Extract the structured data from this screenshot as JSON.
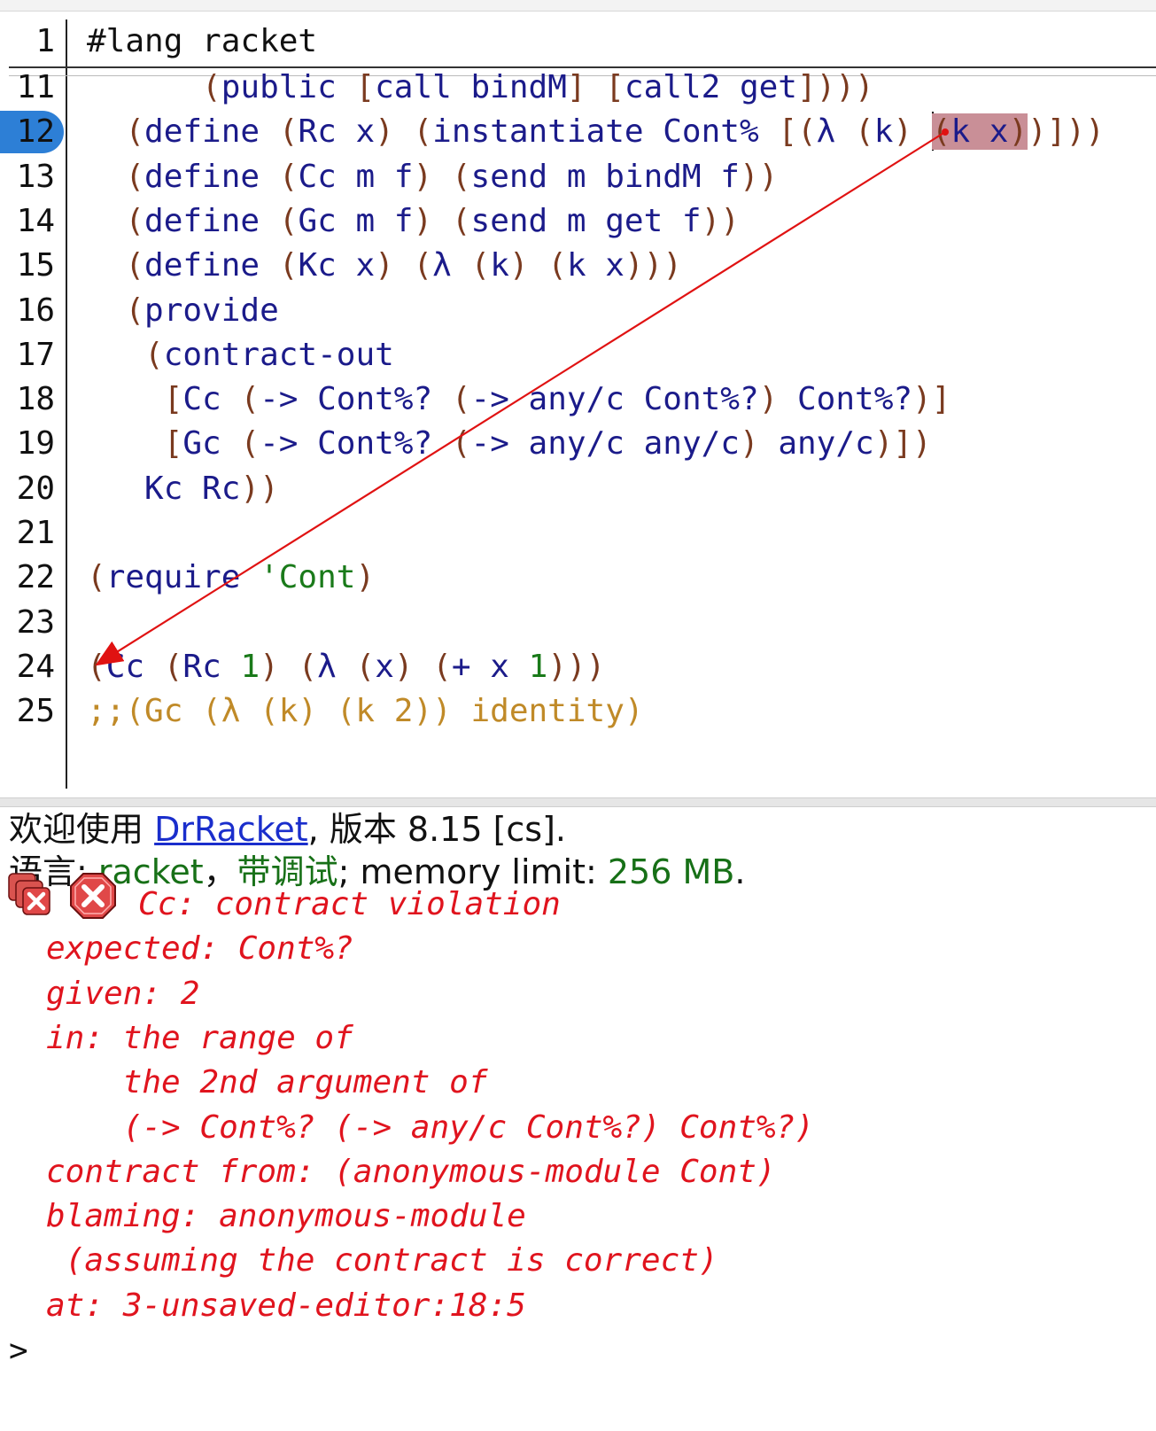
{
  "editor": {
    "header_line": {
      "number": "1",
      "text": "#lang racket"
    },
    "current_line": "12",
    "lines": [
      {
        "number": "11",
        "segments": [
          {
            "t": "      (",
            "c": "paren"
          },
          {
            "t": "public ",
            "c": "sym"
          },
          {
            "t": "[",
            "c": "paren"
          },
          {
            "t": "call bindM",
            "c": "sym"
          },
          {
            "t": "] [",
            "c": "paren"
          },
          {
            "t": "call2 get",
            "c": "sym"
          },
          {
            "t": "])))",
            "c": "paren"
          }
        ]
      },
      {
        "number": "12",
        "segments": [
          {
            "t": "  (",
            "c": "paren"
          },
          {
            "t": "define ",
            "c": "sym"
          },
          {
            "t": "(",
            "c": "paren"
          },
          {
            "t": "Rc x",
            "c": "sym"
          },
          {
            "t": ") (",
            "c": "paren"
          },
          {
            "t": "instantiate Cont% ",
            "c": "sym"
          },
          {
            "t": "[(",
            "c": "paren"
          },
          {
            "t": "λ ",
            "c": "sym"
          },
          {
            "t": "(",
            "c": "paren"
          },
          {
            "t": "k",
            "c": "sym"
          },
          {
            "t": ") ",
            "c": "paren"
          },
          {
            "t": "CURSOR",
            "c": "cursor"
          },
          {
            "t": "(",
            "c": "paren",
            "hl": true
          },
          {
            "t": "k x",
            "c": "sym",
            "hl": true
          },
          {
            "t": ")",
            "c": "paren",
            "hl": true
          },
          {
            "t": ")]))",
            "c": "paren"
          }
        ]
      },
      {
        "number": "13",
        "segments": [
          {
            "t": "  (",
            "c": "paren"
          },
          {
            "t": "define ",
            "c": "sym"
          },
          {
            "t": "(",
            "c": "paren"
          },
          {
            "t": "Cc m f",
            "c": "sym"
          },
          {
            "t": ") (",
            "c": "paren"
          },
          {
            "t": "send m bindM f",
            "c": "sym"
          },
          {
            "t": "))",
            "c": "paren"
          }
        ]
      },
      {
        "number": "14",
        "segments": [
          {
            "t": "  (",
            "c": "paren"
          },
          {
            "t": "define ",
            "c": "sym"
          },
          {
            "t": "(",
            "c": "paren"
          },
          {
            "t": "Gc m f",
            "c": "sym"
          },
          {
            "t": ") (",
            "c": "paren"
          },
          {
            "t": "send m get f",
            "c": "sym"
          },
          {
            "t": "))",
            "c": "paren"
          }
        ]
      },
      {
        "number": "15",
        "segments": [
          {
            "t": "  (",
            "c": "paren"
          },
          {
            "t": "define ",
            "c": "sym"
          },
          {
            "t": "(",
            "c": "paren"
          },
          {
            "t": "Kc x",
            "c": "sym"
          },
          {
            "t": ") (",
            "c": "paren"
          },
          {
            "t": "λ ",
            "c": "sym"
          },
          {
            "t": "(",
            "c": "paren"
          },
          {
            "t": "k",
            "c": "sym"
          },
          {
            "t": ") (",
            "c": "paren"
          },
          {
            "t": "k x",
            "c": "sym"
          },
          {
            "t": ")))",
            "c": "paren"
          }
        ]
      },
      {
        "number": "16",
        "segments": [
          {
            "t": "  (",
            "c": "paren"
          },
          {
            "t": "provide",
            "c": "sym"
          }
        ]
      },
      {
        "number": "17",
        "segments": [
          {
            "t": "   (",
            "c": "paren"
          },
          {
            "t": "contract-out",
            "c": "sym"
          }
        ]
      },
      {
        "number": "18",
        "segments": [
          {
            "t": "    [",
            "c": "paren"
          },
          {
            "t": "Cc ",
            "c": "sym"
          },
          {
            "t": "(",
            "c": "paren"
          },
          {
            "t": "-> Cont%? ",
            "c": "sym"
          },
          {
            "t": "(",
            "c": "paren"
          },
          {
            "t": "-> any/c Cont%?",
            "c": "sym"
          },
          {
            "t": ") ",
            "c": "paren"
          },
          {
            "t": "Cont%?",
            "c": "sym"
          },
          {
            "t": ")]",
            "c": "paren"
          }
        ]
      },
      {
        "number": "19",
        "segments": [
          {
            "t": "    [",
            "c": "paren"
          },
          {
            "t": "Gc ",
            "c": "sym"
          },
          {
            "t": "(",
            "c": "paren"
          },
          {
            "t": "-> Cont%? ",
            "c": "sym"
          },
          {
            "t": "(",
            "c": "paren"
          },
          {
            "t": "-> any/c any/c",
            "c": "sym"
          },
          {
            "t": ") ",
            "c": "paren"
          },
          {
            "t": "any/c",
            "c": "sym"
          },
          {
            "t": ")])",
            "c": "paren"
          }
        ]
      },
      {
        "number": "20",
        "segments": [
          {
            "t": "   Kc Rc",
            "c": "sym"
          },
          {
            "t": "))",
            "c": "paren"
          }
        ]
      },
      {
        "number": "21",
        "segments": []
      },
      {
        "number": "22",
        "segments": [
          {
            "t": "(",
            "c": "paren"
          },
          {
            "t": "require ",
            "c": "sym"
          },
          {
            "t": "'Cont",
            "c": "str"
          },
          {
            "t": ")",
            "c": "paren"
          }
        ]
      },
      {
        "number": "23",
        "segments": []
      },
      {
        "number": "24",
        "segments": [
          {
            "t": "(",
            "c": "paren"
          },
          {
            "t": "Cc ",
            "c": "sym"
          },
          {
            "t": "(",
            "c": "paren"
          },
          {
            "t": "Rc ",
            "c": "sym"
          },
          {
            "t": "1",
            "c": "num"
          },
          {
            "t": ") (",
            "c": "paren"
          },
          {
            "t": "λ ",
            "c": "sym"
          },
          {
            "t": "(",
            "c": "paren"
          },
          {
            "t": "x",
            "c": "sym"
          },
          {
            "t": ") (",
            "c": "paren"
          },
          {
            "t": "+ x ",
            "c": "sym"
          },
          {
            "t": "1",
            "c": "num"
          },
          {
            "t": ")))",
            "c": "paren"
          }
        ]
      },
      {
        "number": "25",
        "segments": [
          {
            "t": ";;(Gc (λ (k) (k 2)) identity)",
            "c": "comment"
          }
        ]
      }
    ]
  },
  "interactions": {
    "welcome_prefix": "欢迎使用 ",
    "welcome_link": "DrRacket",
    "welcome_suffix": ", 版本 8.15 [cs].",
    "lang_prefix": "语言: ",
    "lang_name": "racket",
    "lang_sep": "，",
    "lang_debug": "带调试",
    "lang_mid": "; memory limit: ",
    "memory": "256 MB",
    "lang_end": ".",
    "error_lines": [
      "Cc: contract violation",
      "expected: Cont%?",
      "given: 2",
      "in: the range of",
      "    the 2nd argument of",
      "    (-> Cont%? (-> any/c Cont%?) Cont%?)",
      "contract from: (anonymous-module Cont)",
      "blaming: anonymous-module",
      " (assuming the contract is correct)",
      "at: 3-unsaved-editor:18:5"
    ],
    "prompt": ">",
    "icons": [
      "stack-trace-icon",
      "error-icon"
    ],
    "colors": {
      "error": "#e0141e",
      "link": "#1a2ecc",
      "highlight": "#c98f97",
      "current_line_marker": "#2d7fd6"
    }
  }
}
